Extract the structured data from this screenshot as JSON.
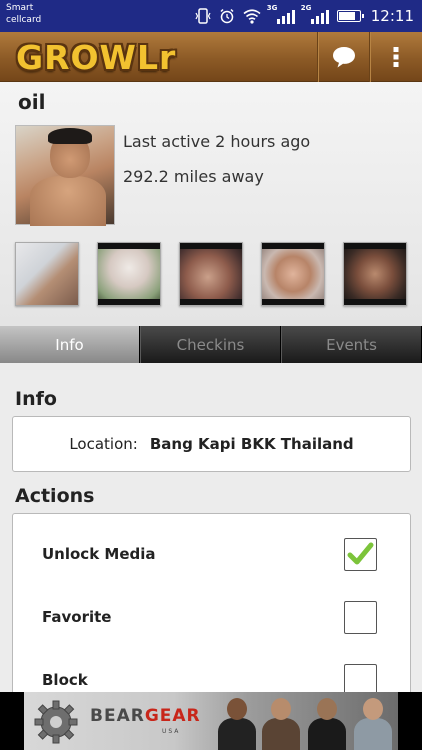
{
  "status_bar": {
    "carrier_line1": "Smart",
    "carrier_line2": "cellcard",
    "network_1": "3G",
    "network_2": "2G",
    "time": "12:11"
  },
  "app": {
    "logo_text": "GROWLr",
    "icons": {
      "chat": "chat-bubble-icon",
      "menu": "overflow-menu-icon"
    }
  },
  "profile": {
    "name": "oil",
    "last_active": "Last active 2 hours ago",
    "distance": "292.2 miles away"
  },
  "tabs": [
    {
      "label": "Info",
      "active": true
    },
    {
      "label": "Checkins",
      "active": false
    },
    {
      "label": "Events",
      "active": false
    }
  ],
  "info": {
    "title": "Info",
    "location_label": "Location:",
    "location_value": "Bang Kapi BKK Thailand"
  },
  "actions": {
    "title": "Actions",
    "items": [
      {
        "label": "Unlock Media",
        "checked": true
      },
      {
        "label": "Favorite",
        "checked": false
      },
      {
        "label": "Block",
        "checked": false
      }
    ]
  },
  "ad": {
    "brand_1": "BEAR",
    "brand_2": "GEAR",
    "brand_sub": "USA"
  },
  "colors": {
    "status_bar": "#1f2a86",
    "app_bar": "#8c5a26",
    "logo": "#f2c230",
    "checkmark": "#7cc43a"
  }
}
